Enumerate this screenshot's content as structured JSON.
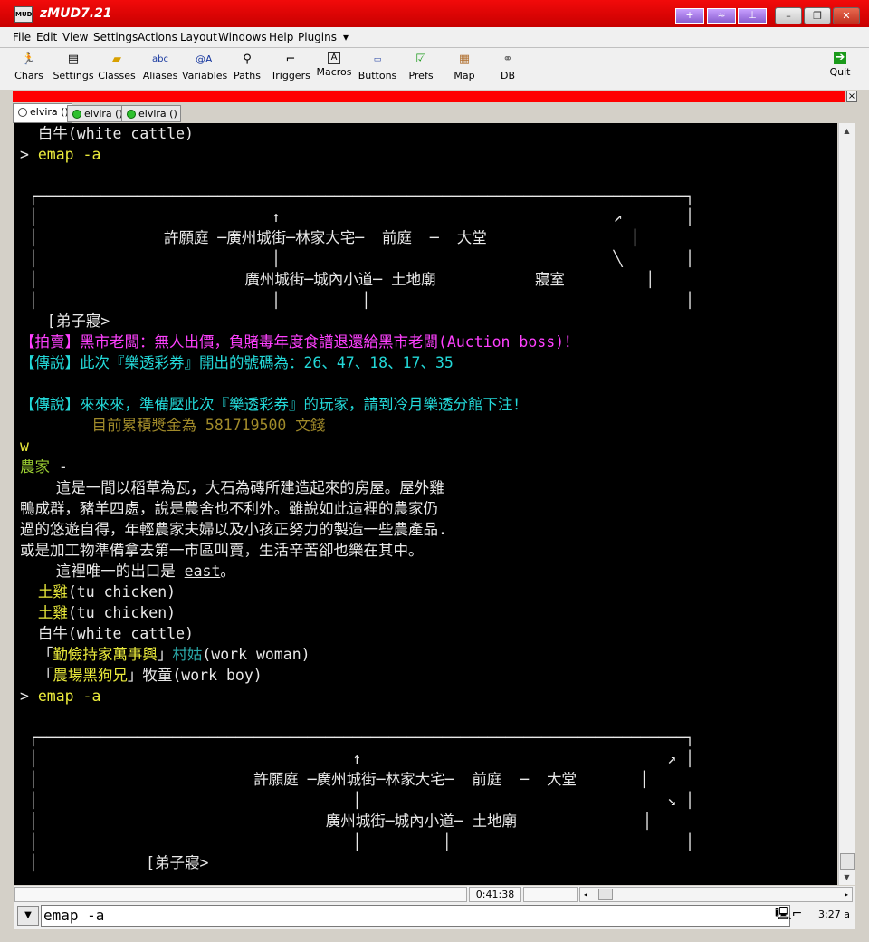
{
  "window": {
    "app_icon_text": "MUD",
    "title": "zMUD7.21",
    "title_buttons": [
      "+",
      "≈",
      "⊥"
    ],
    "controls": [
      "–",
      "❐",
      "✕"
    ]
  },
  "menu": [
    "File",
    "Edit",
    "View",
    "Settings",
    "Actions",
    "Layout",
    "Windows",
    "Help",
    "Plugins",
    "▾"
  ],
  "toolbar": [
    {
      "label": "Chars",
      "icon": "running-man-icon"
    },
    {
      "label": "Settings",
      "icon": "settings-icon"
    },
    {
      "label": "Classes",
      "icon": "folder-icon"
    },
    {
      "label": "Aliases",
      "icon": "abc-icon"
    },
    {
      "label": "Variables",
      "icon": "variables-icon"
    },
    {
      "label": "Paths",
      "icon": "paths-icon"
    },
    {
      "label": "Triggers",
      "icon": "gun-icon"
    },
    {
      "label": "Macros",
      "icon": "key-icon"
    },
    {
      "label": "Buttons",
      "icon": "buttons-icon"
    },
    {
      "label": "Prefs",
      "icon": "checkbox-icon"
    },
    {
      "label": "Map",
      "icon": "map-icon"
    },
    {
      "label": "DB",
      "icon": "db-icon"
    },
    {
      "label": "Quit",
      "icon": "exit-icon"
    }
  ],
  "tabs": [
    "elvira ()",
    "elvira ()",
    "elvira ()"
  ],
  "terminal": {
    "lines": [
      [
        {
          "t": "  白牛(white cattle)",
          "c": "c-white"
        }
      ],
      [
        {
          "t": "> ",
          "c": "c-white"
        },
        {
          "t": "emap -a",
          "c": "c-yellow"
        }
      ],
      [
        {
          "t": "",
          "c": ""
        }
      ],
      [
        {
          "t": " ┌────────────────────────────────────────────────────────────────────────┐",
          "c": "c-white"
        }
      ],
      [
        {
          "t": " │                          ↑                                     ↗       │",
          "c": "c-white"
        }
      ],
      [
        {
          "t": " │              許願庭 ─廣州城街─林家大宅─  前庭  ─  大堂                │",
          "c": "c-white"
        }
      ],
      [
        {
          "t": " │                          │                                     ╲       │",
          "c": "c-white"
        }
      ],
      [
        {
          "t": " │                       廣州城街─城內小道─ 土地廟           寢室         │",
          "c": "c-white"
        }
      ],
      [
        {
          "t": " │                          │         │                                   │",
          "c": "c-white"
        }
      ],
      [
        {
          "t": "   [弟子寢>",
          "c": "c-white"
        }
      ],
      [
        {
          "t": "【拍賣】黑市老闆：無人出價，負賭毒年度食譜退還給黑市老闆(Auction boss)！",
          "c": "c-magenta"
        }
      ],
      [
        {
          "t": "【傳說】此次『樂透彩券』開出的號碼為：26、47、18、17、35",
          "c": "c-cyan"
        }
      ],
      [
        {
          "t": "",
          "c": ""
        }
      ],
      [
        {
          "t": "【傳說】來來來，準備壓此次『樂透彩券』的玩家，請到冷月樂透分館下注！",
          "c": "c-cyan"
        }
      ],
      [
        {
          "t": "        目前累積獎金為 581719500 文錢",
          "c": "c-olive"
        }
      ],
      [
        {
          "t": "w",
          "c": "c-yellow"
        }
      ],
      [
        {
          "t": "農家",
          "c": "c-lime"
        },
        {
          "t": " -",
          "c": "c-white"
        }
      ],
      [
        {
          "t": "    這是一間以稻草為瓦，大石為磚所建造起來的房屋。屋外雞",
          "c": "c-white"
        }
      ],
      [
        {
          "t": "鴨成群，豬羊四處，說是農舍也不利外。雖說如此這裡的農家仍",
          "c": "c-white"
        }
      ],
      [
        {
          "t": "過的悠遊自得，年輕農家夫婦以及小孩正努力的製造一些農產品.",
          "c": "c-white"
        }
      ],
      [
        {
          "t": "或是加工物準備拿去第一市區叫賣，生活辛苦卻也樂在其中。",
          "c": "c-white"
        }
      ],
      [
        {
          "t": "    這裡唯一的出口是 ",
          "c": "c-white"
        },
        {
          "t": "east",
          "c": "c-white u"
        },
        {
          "t": "。",
          "c": "c-white"
        }
      ],
      [
        {
          "t": "  土雞",
          "c": "c-yellow"
        },
        {
          "t": "(tu chicken)",
          "c": "c-white"
        }
      ],
      [
        {
          "t": "  土雞",
          "c": "c-yellow"
        },
        {
          "t": "(tu chicken)",
          "c": "c-white"
        }
      ],
      [
        {
          "t": "  白牛(white cattle)",
          "c": "c-white"
        }
      ],
      [
        {
          "t": "  「",
          "c": "c-white"
        },
        {
          "t": "勤儉持家萬事興",
          "c": "c-yellow"
        },
        {
          "t": "」",
          "c": "c-white"
        },
        {
          "t": "村姑",
          "c": "c-teal"
        },
        {
          "t": "(work woman)",
          "c": "c-white"
        }
      ],
      [
        {
          "t": "  「",
          "c": "c-white"
        },
        {
          "t": "農場黑狗兄",
          "c": "c-yellow"
        },
        {
          "t": "」牧童(work boy)",
          "c": "c-white"
        }
      ],
      [
        {
          "t": "> ",
          "c": "c-white"
        },
        {
          "t": "emap -a",
          "c": "c-yellow"
        }
      ],
      [
        {
          "t": "",
          "c": ""
        }
      ],
      [
        {
          "t": " ┌────────────────────────────────────────────────────────────────────────┐",
          "c": "c-white"
        }
      ],
      [
        {
          "t": " │                                   ↑                                  ↗ │",
          "c": "c-white"
        }
      ],
      [
        {
          "t": " │                        許願庭 ─廣州城街─林家大宅─  前庭  ─  大堂       │",
          "c": "c-white"
        }
      ],
      [
        {
          "t": " │                                   │                                  ↘ │",
          "c": "c-white"
        }
      ],
      [
        {
          "t": " │                                廣州城街─城內小道─ 土地廟              │",
          "c": "c-white"
        }
      ],
      [
        {
          "t": " │                                   │         │                          │",
          "c": "c-white"
        }
      ],
      [
        {
          "t": " │            [弟子寢>",
          "c": "c-white"
        }
      ]
    ]
  },
  "status": {
    "timer": "0:41:38",
    "scroll_left": "◂",
    "scroll_right": "▸"
  },
  "input": {
    "value": "emap -a",
    "clock": "3:27 a"
  }
}
